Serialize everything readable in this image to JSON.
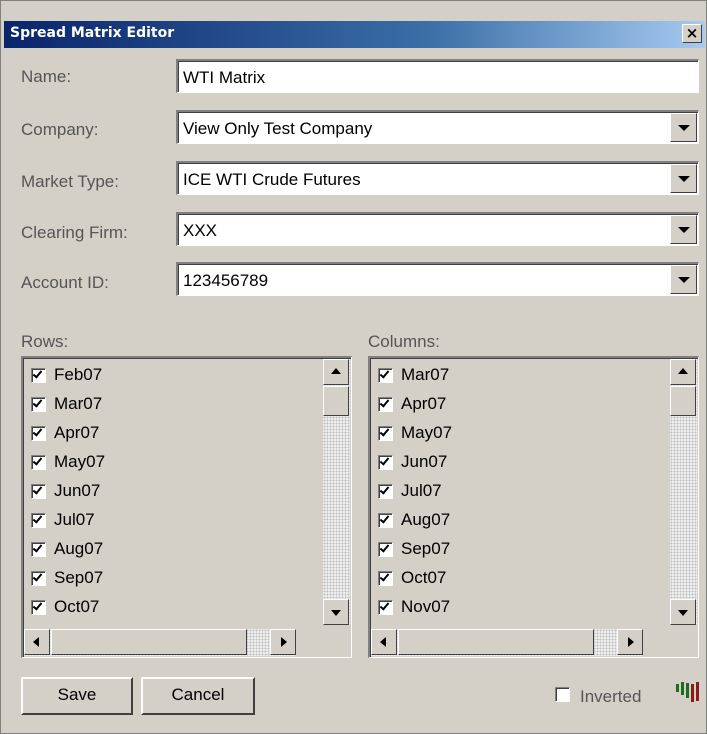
{
  "window": {
    "title": "Spread Matrix Editor",
    "close_glyph": "×"
  },
  "form": {
    "name_label": "Name:",
    "name_value": "WTI Matrix",
    "company_label": "Company:",
    "company_value": "View Only Test Company",
    "market_type_label": "Market Type:",
    "market_type_value": "ICE WTI Crude Futures",
    "clearing_firm_label": "Clearing Firm:",
    "clearing_firm_value": "XXX",
    "account_id_label": "Account ID:",
    "account_id_value": "123456789"
  },
  "rows": {
    "label": "Rows:",
    "items": [
      {
        "label": "Feb07",
        "checked": true
      },
      {
        "label": "Mar07",
        "checked": true
      },
      {
        "label": "Apr07",
        "checked": true
      },
      {
        "label": "May07",
        "checked": true
      },
      {
        "label": "Jun07",
        "checked": true
      },
      {
        "label": "Jul07",
        "checked": true
      },
      {
        "label": "Aug07",
        "checked": true
      },
      {
        "label": "Sep07",
        "checked": true
      },
      {
        "label": "Oct07",
        "checked": true
      }
    ]
  },
  "columns": {
    "label": "Columns:",
    "items": [
      {
        "label": "Mar07",
        "checked": true
      },
      {
        "label": "Apr07",
        "checked": true
      },
      {
        "label": "May07",
        "checked": true
      },
      {
        "label": "Jun07",
        "checked": true
      },
      {
        "label": "Jul07",
        "checked": true
      },
      {
        "label": "Aug07",
        "checked": true
      },
      {
        "label": "Sep07",
        "checked": true
      },
      {
        "label": "Oct07",
        "checked": true
      },
      {
        "label": "Nov07",
        "checked": true
      }
    ]
  },
  "footer": {
    "save_label": "Save",
    "cancel_label": "Cancel",
    "inverted_label": "Inverted",
    "inverted_checked": false
  },
  "icons": {
    "dropdown": "chevron-down-icon",
    "close": "close-icon",
    "logo": "bar-chart-logo-icon"
  },
  "colors": {
    "titlebar_start": "#0a246a",
    "titlebar_end": "#a6caf0",
    "dialog_bg": "#d4d0c8",
    "label_text": "#555555",
    "logo_green": "#1f6b1f",
    "logo_red": "#8a1a1a"
  }
}
